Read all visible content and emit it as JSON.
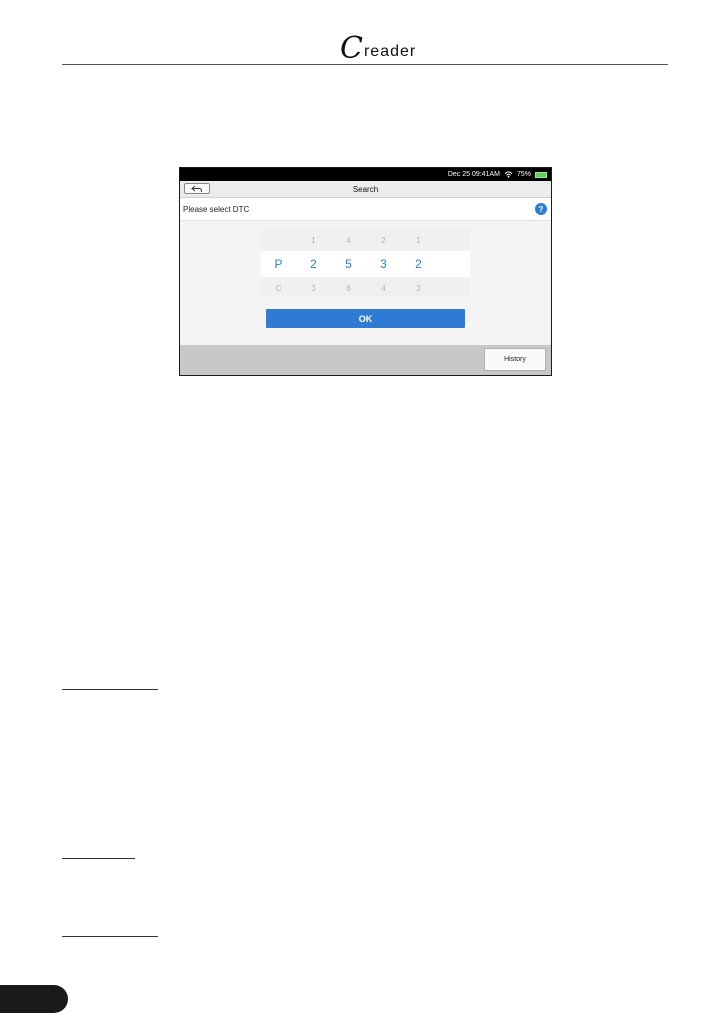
{
  "header": {
    "logo_initial": "C",
    "logo_rest": "read",
    "logo_tail": "er"
  },
  "device": {
    "status": {
      "datetime": "Dec 25 09:41AM",
      "battery": "75%"
    },
    "title": "Search",
    "prompt": "Please select DTC",
    "picker": {
      "rows": [
        [
          "",
          "1",
          "4",
          "2",
          "1"
        ],
        [
          "P",
          "2",
          "5",
          "3",
          "2"
        ],
        [
          "C",
          "3",
          "6",
          "4",
          "3"
        ]
      ]
    },
    "ok_label": "OK",
    "history_label": "History"
  },
  "colors": {
    "accent": "#2f7ad2",
    "status_bar": "#000000",
    "bottom_bar": "#c8c8c8"
  },
  "icons": [
    "back-arrow-icon",
    "wifi-icon",
    "battery-icon",
    "help-icon"
  ]
}
